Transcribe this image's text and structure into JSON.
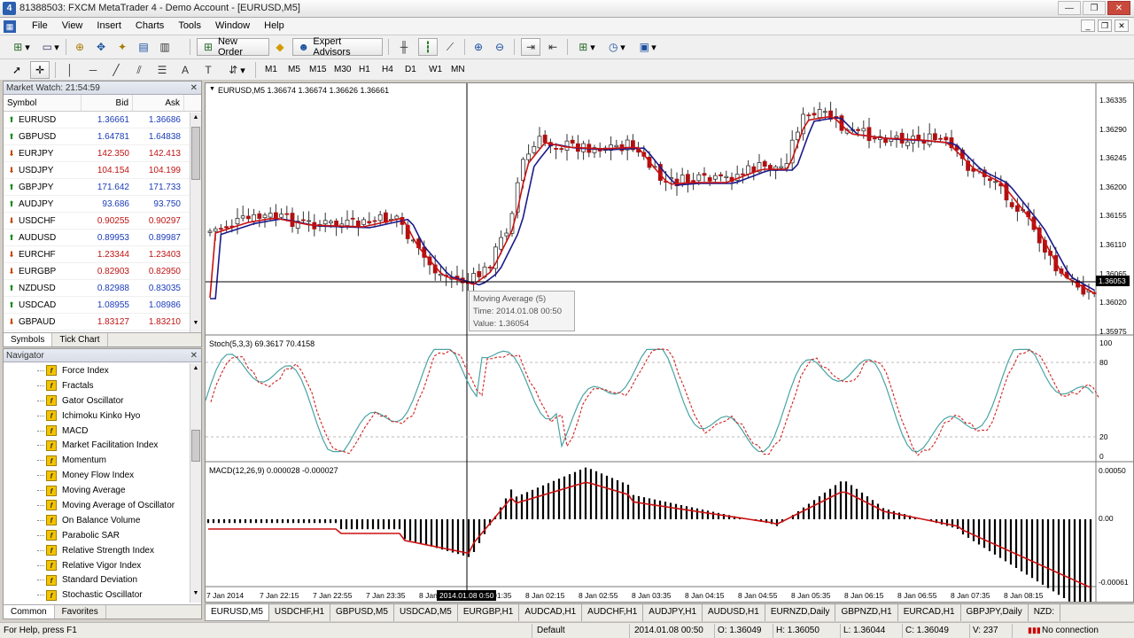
{
  "window": {
    "title": "81388503: FXCM MetaTrader 4 - Demo Account - [EURUSD,M5]",
    "app_icon": "4"
  },
  "menu": [
    "File",
    "View",
    "Insert",
    "Charts",
    "Tools",
    "Window",
    "Help"
  ],
  "toolbar": {
    "new_order": "New Order",
    "expert_advisors": "Expert Advisors",
    "timeframes": [
      "M1",
      "M5",
      "M15",
      "M30",
      "H1",
      "H4",
      "D1",
      "W1",
      "MN"
    ]
  },
  "market_watch": {
    "title": "Market Watch: 21:54:59",
    "columns": [
      "Symbol",
      "Bid",
      "Ask"
    ],
    "rows": [
      {
        "symbol": "EURUSD",
        "bid": "1.36661",
        "ask": "1.36686",
        "dir": "up",
        "color": "blue"
      },
      {
        "symbol": "GBPUSD",
        "bid": "1.64781",
        "ask": "1.64838",
        "dir": "up",
        "color": "blue"
      },
      {
        "symbol": "EURJPY",
        "bid": "142.350",
        "ask": "142.413",
        "dir": "dn",
        "color": "red"
      },
      {
        "symbol": "USDJPY",
        "bid": "104.154",
        "ask": "104.199",
        "dir": "dn",
        "color": "red"
      },
      {
        "symbol": "GBPJPY",
        "bid": "171.642",
        "ask": "171.733",
        "dir": "up",
        "color": "blue"
      },
      {
        "symbol": "AUDJPY",
        "bid": "93.686",
        "ask": "93.750",
        "dir": "up",
        "color": "blue"
      },
      {
        "symbol": "USDCHF",
        "bid": "0.90255",
        "ask": "0.90297",
        "dir": "dn",
        "color": "red"
      },
      {
        "symbol": "AUDUSD",
        "bid": "0.89953",
        "ask": "0.89987",
        "dir": "up",
        "color": "blue"
      },
      {
        "symbol": "EURCHF",
        "bid": "1.23344",
        "ask": "1.23403",
        "dir": "dn",
        "color": "red"
      },
      {
        "symbol": "EURGBP",
        "bid": "0.82903",
        "ask": "0.82950",
        "dir": "dn",
        "color": "red"
      },
      {
        "symbol": "NZDUSD",
        "bid": "0.82988",
        "ask": "0.83035",
        "dir": "up",
        "color": "blue"
      },
      {
        "symbol": "USDCAD",
        "bid": "1.08955",
        "ask": "1.08986",
        "dir": "up",
        "color": "blue"
      },
      {
        "symbol": "GBPAUD",
        "bid": "1.83127",
        "ask": "1.83210",
        "dir": "dn",
        "color": "red"
      }
    ],
    "tabs": [
      "Symbols",
      "Tick Chart"
    ]
  },
  "navigator": {
    "title": "Navigator",
    "items": [
      "Force Index",
      "Fractals",
      "Gator Oscillator",
      "Ichimoku Kinko Hyo",
      "MACD",
      "Market Facilitation Index",
      "Momentum",
      "Money Flow Index",
      "Moving Average",
      "Moving Average of Oscillator",
      "On Balance Volume",
      "Parabolic SAR",
      "Relative Strength Index",
      "Relative Vigor Index",
      "Standard Deviation",
      "Stochastic Oscillator"
    ],
    "tabs": [
      "Common",
      "Favorites"
    ]
  },
  "chart": {
    "header": "EURUSD,M5  1.36674 1.36674 1.36626 1.36661",
    "price_labels": [
      "1.36335",
      "1.36290",
      "1.36245",
      "1.36200",
      "1.36155",
      "1.36110",
      "1.36065",
      "1.36020",
      "1.35975"
    ],
    "current_price": "1.36053",
    "tooltip": {
      "line1": "Moving Average (5)",
      "line2": "Time: 2014.01.08 00:50",
      "line3": "Value: 1.36054"
    },
    "stoch_header": "Stoch(5,3,3) 69.3617 70.4158",
    "stoch_levels": [
      "100",
      "80",
      "20",
      "0"
    ],
    "macd_header": "MACD(12,26,9) 0.000028 -0.000027",
    "macd_levels": [
      "0.00050",
      "0.00",
      "-0.00061"
    ],
    "time_labels": [
      "7 Jan 2014",
      "7 Jan 22:15",
      "7 Jan 22:55",
      "7 Jan 23:35",
      "8 Jan",
      "8 Jan 01:35",
      "8 Jan 02:15",
      "8 Jan 02:55",
      "8 Jan 03:35",
      "8 Jan 04:15",
      "8 Jan 04:55",
      "8 Jan 05:35",
      "8 Jan 06:15",
      "8 Jan 06:55",
      "8 Jan 07:35",
      "8 Jan 08:15"
    ],
    "cursor_time": "2014.01.08 0:50",
    "colors": {
      "ma_fast": "#cc1111",
      "ma_slow": "#1a1a8c",
      "bull": "#ffffff",
      "bear": "#b01010",
      "stoch_main": "#4aa3a3",
      "stoch_signal": "#d22222"
    }
  },
  "chart_tabs": [
    "EURUSD,M5",
    "USDCHF,H1",
    "GBPUSD,M5",
    "USDCAD,M5",
    "EURGBP,H1",
    "AUDCAD,H1",
    "AUDCHF,H1",
    "AUDJPY,H1",
    "AUDUSD,H1",
    "EURNZD,Daily",
    "GBPNZD,H1",
    "EURCAD,H1",
    "GBPJPY,Daily",
    "NZD:"
  ],
  "status": {
    "help": "For Help, press F1",
    "profile": "Default",
    "time": "2014.01.08 00:50",
    "open": "O: 1.36049",
    "high": "H: 1.36050",
    "low": "L: 1.36044",
    "close": "C: 1.36049",
    "volume": "V: 237",
    "connection": "No connection"
  }
}
